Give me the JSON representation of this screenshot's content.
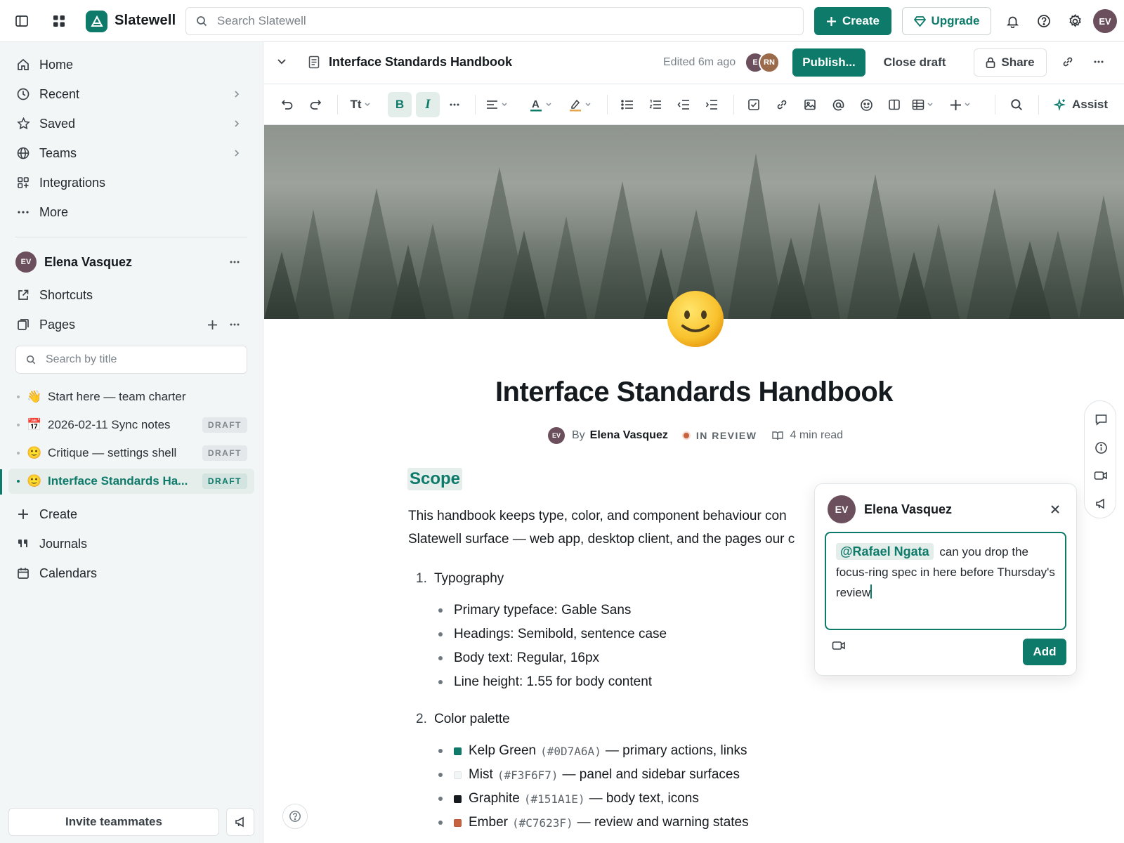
{
  "app": {
    "name": "Slatewell"
  },
  "topbar": {
    "search_placeholder": "Search Slatewell",
    "create_label": "Create",
    "upgrade_label": "Upgrade",
    "user_initials": "EV"
  },
  "sidebar": {
    "nav": [
      {
        "label": "Home",
        "icon": "home-icon"
      },
      {
        "label": "Recent",
        "icon": "clock-icon",
        "chevron": true
      },
      {
        "label": "Saved",
        "icon": "star-icon",
        "chevron": true
      },
      {
        "label": "Teams",
        "icon": "globe-icon",
        "chevron": true
      },
      {
        "label": "Integrations",
        "icon": "apps-icon"
      },
      {
        "label": "More",
        "icon": "more-icon"
      }
    ],
    "user": {
      "initials": "EV",
      "name": "Elena Vasquez"
    },
    "shortcuts_label": "Shortcuts",
    "pages_label": "Pages",
    "search_placeholder": "Search by title",
    "pages": [
      {
        "emoji": "👋",
        "title": "Start here — team charter",
        "badge": ""
      },
      {
        "emoji": "📅",
        "title": "2026-02-11 Sync notes",
        "badge": "DRAFT"
      },
      {
        "emoji": "🙂",
        "title": "Critique — settings shell",
        "badge": "DRAFT"
      },
      {
        "emoji": "🙂",
        "title": "Interface Standards Ha...",
        "badge": "DRAFT",
        "active": true
      }
    ],
    "create_label": "Create",
    "journals_label": "Journals",
    "calendars_label": "Calendars",
    "invite_label": "Invite teammates"
  },
  "doc_header": {
    "title": "Interface Standards Handbook",
    "edited": "Edited 6m ago",
    "collaborators": [
      {
        "initials": "E",
        "color": "#6C4F5C"
      },
      {
        "initials": "RN",
        "color": "#9A6A4B"
      }
    ],
    "publish_label": "Publish...",
    "close_draft_label": "Close draft",
    "share_label": "Share"
  },
  "toolbar": {
    "text_size_label": "Tt",
    "bold_label": "B",
    "italic_label": "I",
    "assist_label": "Assist"
  },
  "document": {
    "title": "Interface Standards Handbook",
    "author_initials": "EV",
    "by_label": "By",
    "author": "Elena Vasquez",
    "status": "IN REVIEW",
    "read_time": "4 min read",
    "heading": "Scope",
    "paragraph_line1": "This handbook keeps type, color, and component behaviour con",
    "paragraph_line2": "Slatewell surface — web app, desktop client, and the pages our c",
    "list": [
      {
        "num": "1.",
        "title": "Typography",
        "items": [
          "Primary typeface: Gable Sans",
          "Headings: Semibold, sentence case",
          "Body text: Regular, 16px",
          "Line height: 1.55 for body content"
        ]
      },
      {
        "num": "2.",
        "title": "Color palette",
        "colors": [
          {
            "name": "Kelp Green",
            "hex": "(#0D7A6A)",
            "desc": "— primary actions, links",
            "swatch": "#0D7A6A"
          },
          {
            "name": "Mist",
            "hex": "(#F3F6F7)",
            "desc": "— panel and sidebar surfaces",
            "swatch": "#F3F6F7"
          },
          {
            "name": "Graphite",
            "hex": "(#151A1E)",
            "desc": "— body text, icons",
            "swatch": "#151A1E"
          },
          {
            "name": "Ember",
            "hex": "(#C7623F)",
            "desc": "— review and warning states",
            "swatch": "#C7623F"
          }
        ]
      }
    ]
  },
  "comment": {
    "initials": "EV",
    "author": "Elena Vasquez",
    "mention": "@Rafael Ngata",
    "text": "can you drop the focus-ring spec in here before Thursday's review",
    "add_label": "Add"
  }
}
